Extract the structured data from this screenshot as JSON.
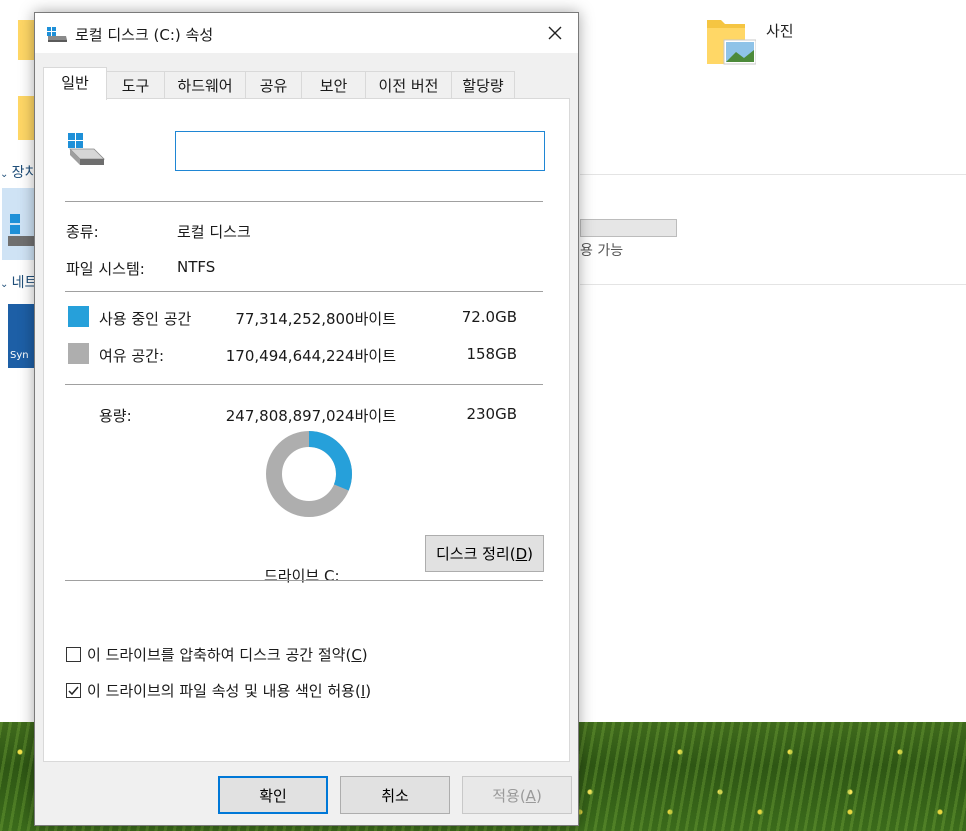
{
  "background": {
    "folder_label": "사진",
    "nav_devices": "장치",
    "nav_network": "네트",
    "drive_free_text": "용 가능",
    "icon_text": "Syn"
  },
  "dialog": {
    "title": "로컬 디스크 (C:) 속성",
    "close_icon": "close-icon",
    "tabs": [
      {
        "label": "일반",
        "active": true
      },
      {
        "label": "도구"
      },
      {
        "label": "하드웨어"
      },
      {
        "label": "공유"
      },
      {
        "label": "보안"
      },
      {
        "label": "이전 버전"
      },
      {
        "label": "할당량"
      }
    ],
    "name_input_value": "",
    "type_label": "종류:",
    "type_value": "로컬 디스크",
    "fs_label": "파일 시스템:",
    "fs_value": "NTFS",
    "used_label": "사용 중인 공간",
    "used_bytes": "77,314,252,800바이트",
    "used_size": "72.0GB",
    "free_label": "여유 공간:",
    "free_bytes": "170,494,644,224바이트",
    "free_size": "158GB",
    "capacity_label": "용량:",
    "capacity_bytes": "247,808,897,024바이트",
    "capacity_size": "230GB",
    "drive_label": "드라이브 C:",
    "cleanup_label": "디스크 정리",
    "cleanup_key": "D",
    "compress_label": "이 드라이브를 압축하여 디스크 공간 절약",
    "compress_key": "C",
    "compress_checked": false,
    "index_label": "이 드라이브의 파일 속성 및 내용 색인 허용",
    "index_key": "I",
    "index_checked": true,
    "ok_label": "확인",
    "cancel_label": "취소",
    "apply_label": "적용",
    "apply_key": "A",
    "used_fraction": 0.312,
    "colors": {
      "used": "#26a0da",
      "free": "#aeaeae",
      "accent": "#0078d7"
    }
  }
}
